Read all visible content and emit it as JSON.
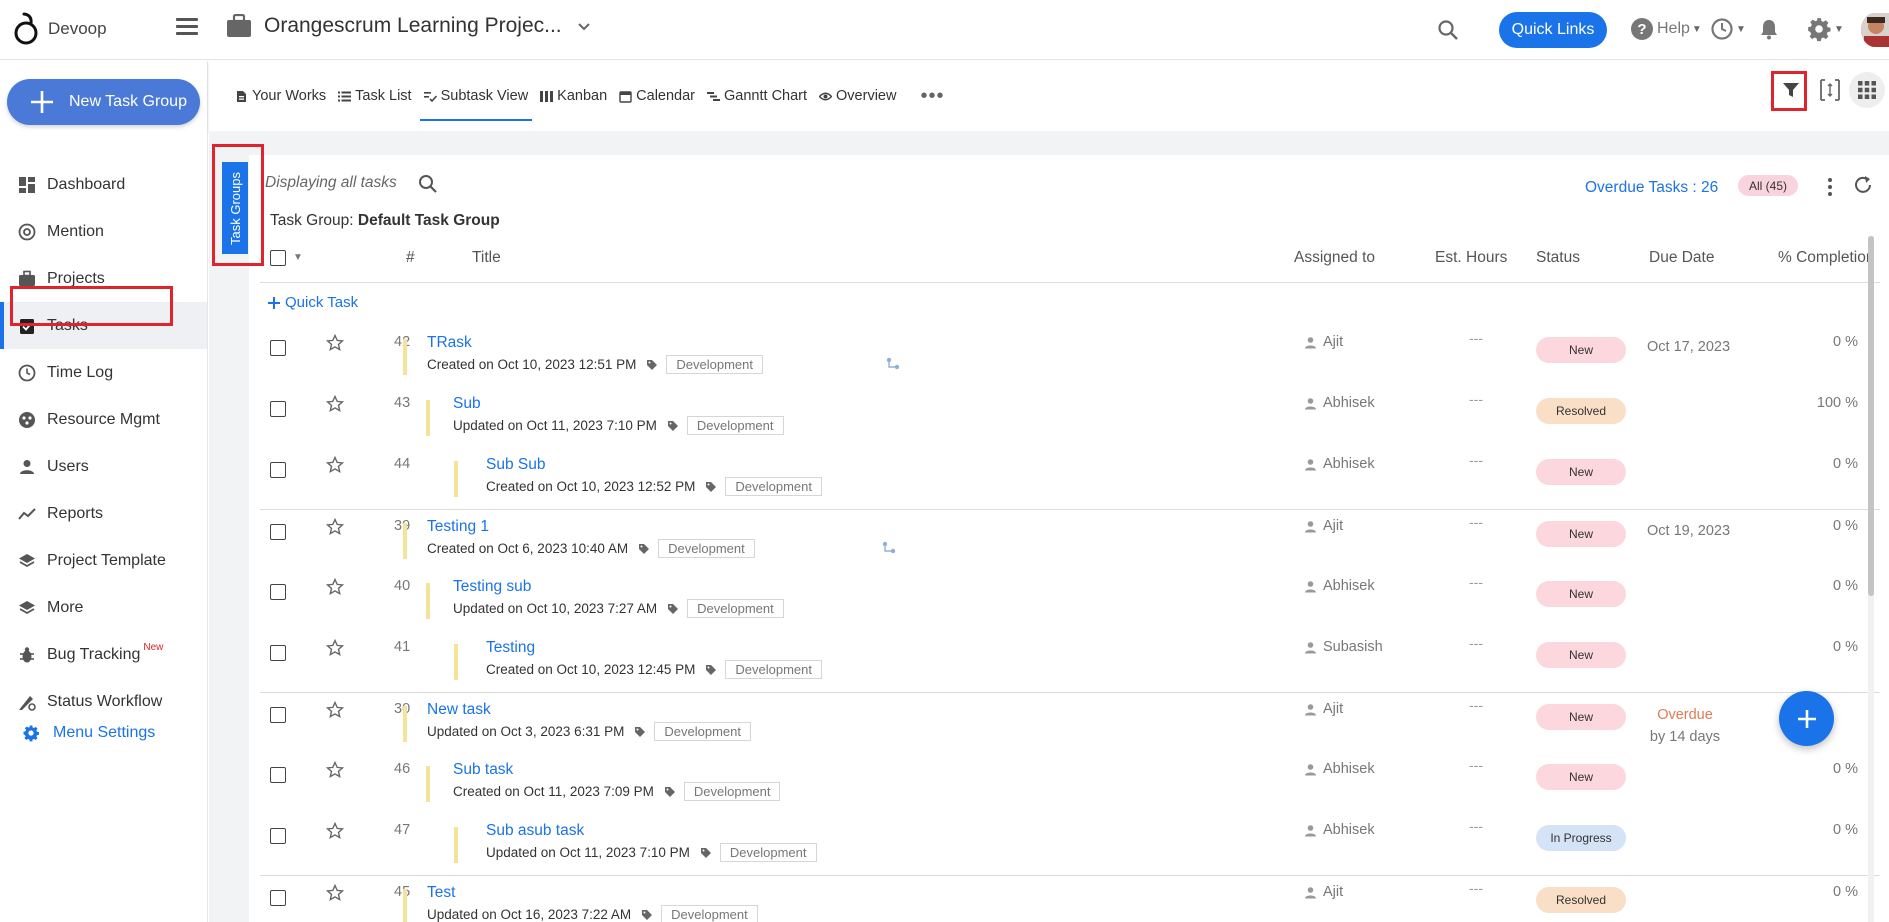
{
  "brand": {
    "name": "Devoop"
  },
  "header": {
    "project_name": "Orangescrum Learning Projec...",
    "quick_links": "Quick Links",
    "help": "Help"
  },
  "sidebar": {
    "new_task_group": "New Task Group",
    "items": [
      {
        "label": "Dashboard",
        "icon": "dashboard-icon"
      },
      {
        "label": "Mention",
        "icon": "at-icon"
      },
      {
        "label": "Projects",
        "icon": "briefcase-icon"
      },
      {
        "label": "Tasks",
        "icon": "tasks-icon",
        "active": true
      },
      {
        "label": "Time Log",
        "icon": "clock-icon"
      },
      {
        "label": "Resource Mgmt",
        "icon": "resource-icon"
      },
      {
        "label": "Users",
        "icon": "user-icon"
      },
      {
        "label": "Reports",
        "icon": "chart-line-icon"
      },
      {
        "label": "Project Template",
        "icon": "layers-icon"
      },
      {
        "label": "More",
        "icon": "layers-icon"
      },
      {
        "label": "Bug Tracking",
        "icon": "bug-icon",
        "badge": "New"
      },
      {
        "label": "Status Workflow",
        "icon": "workflow-icon"
      }
    ],
    "menu_settings": "Menu Settings"
  },
  "subnav": {
    "tabs": [
      {
        "label": "Your Works",
        "icon": "document-icon"
      },
      {
        "label": "Task List",
        "icon": "list-icon"
      },
      {
        "label": "Subtask View",
        "icon": "subtask-icon",
        "active": true
      },
      {
        "label": "Kanban",
        "icon": "kanban-icon"
      },
      {
        "label": "Calendar",
        "icon": "calendar-icon"
      },
      {
        "label": "Ganntt Chart",
        "icon": "gantt-icon"
      },
      {
        "label": "Overview",
        "icon": "eye-icon"
      }
    ]
  },
  "panel": {
    "task_groups_tab": "Task Groups",
    "displaying": "Displaying all tasks",
    "overdue": "Overdue Tasks : 26",
    "all_count": "All (45)",
    "group_label": "Task Group:",
    "group_name": "Default Task Group",
    "quick_task": "Quick Task"
  },
  "table": {
    "headers": {
      "num": "#",
      "title": "Title",
      "assigned": "Assigned to",
      "est": "Est. Hours",
      "status": "Status",
      "due": "Due Date",
      "completion": "% Completion"
    },
    "rows": [
      {
        "num": "42",
        "level": 0,
        "title": "TRask",
        "meta": "Created on Oct 10, 2023 12:51 PM",
        "tag": "Development",
        "assignee": "Ajit",
        "est": "---",
        "status": "New",
        "due": "Oct 17, 2023",
        "pct": "0 %",
        "sub_icon": true
      },
      {
        "num": "43",
        "level": 1,
        "title": "Sub",
        "meta": "Updated on Oct 11, 2023 7:10 PM",
        "tag": "Development",
        "assignee": "Abhisek",
        "est": "---",
        "status": "Resolved",
        "due": "",
        "pct": "100 %"
      },
      {
        "num": "44",
        "level": 2,
        "title": "Sub Sub",
        "meta": "Created on Oct 10, 2023 12:52 PM",
        "tag": "Development",
        "assignee": "Abhisek",
        "est": "---",
        "status": "New",
        "due": "",
        "pct": "0 %"
      },
      {
        "num": "39",
        "level": 0,
        "title": "Testing 1",
        "meta": "Created on Oct 6, 2023 10:40 AM",
        "tag": "Development",
        "assignee": "Ajit",
        "est": "---",
        "status": "New",
        "due": "Oct 19, 2023",
        "pct": "0 %",
        "sub_icon": true
      },
      {
        "num": "40",
        "level": 1,
        "title": "Testing sub",
        "meta": "Updated on Oct 10, 2023 7:27 AM",
        "tag": "Development",
        "assignee": "Abhisek",
        "est": "---",
        "status": "New",
        "due": "",
        "pct": "0 %"
      },
      {
        "num": "41",
        "level": 2,
        "title": "Testing",
        "meta": "Created on Oct 10, 2023 12:45 PM",
        "tag": "Development",
        "assignee": "Subasish",
        "est": "---",
        "status": "New",
        "due": "",
        "pct": "0 %"
      },
      {
        "num": "30",
        "level": 0,
        "title": "New task",
        "meta": "Updated on Oct 3, 2023 6:31 PM",
        "tag": "Development",
        "assignee": "Ajit",
        "est": "---",
        "status": "New",
        "overdue": "Overdue",
        "overdue_by": "by 14 days",
        "pct": ""
      },
      {
        "num": "46",
        "level": 1,
        "title": "Sub task",
        "meta": "Created on Oct 11, 2023 7:09 PM",
        "tag": "Development",
        "assignee": "Abhisek",
        "est": "---",
        "status": "New",
        "due": "",
        "pct": "0 %"
      },
      {
        "num": "47",
        "level": 2,
        "title": "Sub asub task",
        "meta": "Updated on Oct 11, 2023 7:10 PM",
        "tag": "Development",
        "assignee": "Abhisek",
        "est": "---",
        "status": "In Progress",
        "due": "",
        "pct": "0 %"
      },
      {
        "num": "45",
        "level": 0,
        "title": "Test",
        "meta": "Updated on Oct 16, 2023 7:22 AM",
        "tag": "Development",
        "assignee": "Ajit",
        "est": "---",
        "status": "Resolved",
        "due": "",
        "pct": "0 %"
      }
    ]
  },
  "colors": {
    "primary": "#1a73e8",
    "highlight": "#e0232c",
    "status_new": "#fcd7dd",
    "status_resolved": "#fadfc7",
    "status_in_progress": "#d4e3f6"
  }
}
